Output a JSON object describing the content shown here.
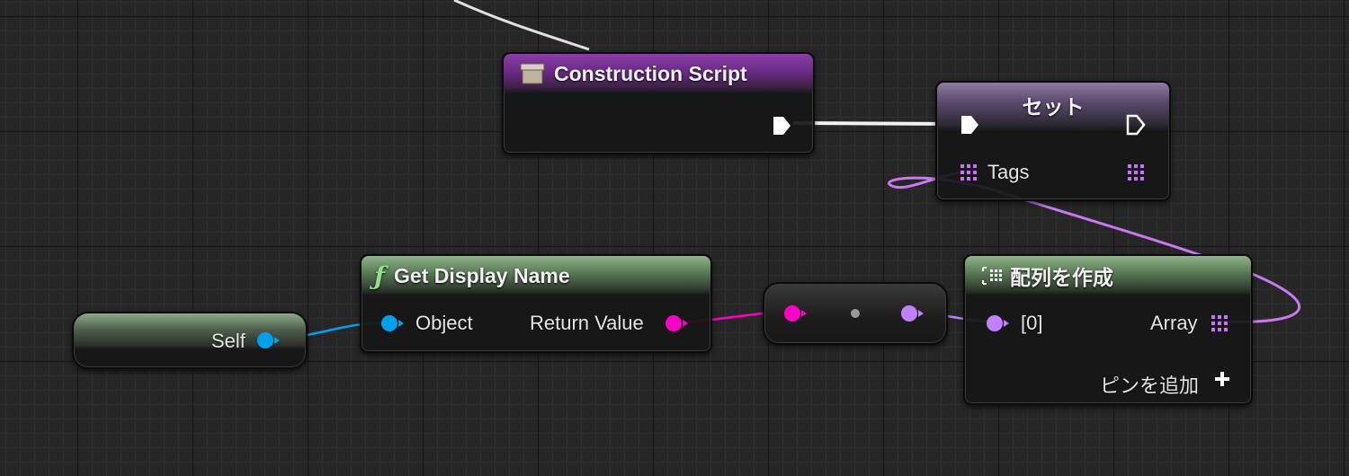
{
  "colors": {
    "exec": "#ffffff",
    "object_pin": "#00a0f0",
    "string_pin": "#ff00c8",
    "name_pin": "#c080ff",
    "array_pin": "#c870ff",
    "event_header": "#7b3598",
    "function_header": "#66885f"
  },
  "nodes": {
    "construction_script": {
      "title": "Construction Script",
      "icon": "event-box-icon"
    },
    "set_tags": {
      "title": "セット",
      "input_label": "Tags"
    },
    "self_node": {
      "label": "Self"
    },
    "get_display_name": {
      "title": "Get Display Name",
      "icon": "function-icon",
      "input_label": "Object",
      "output_label": "Return Value"
    },
    "conversion": {
      "icon": "conversion-dot-icon"
    },
    "make_array": {
      "title": "配列を作成",
      "icon": "make-array-icon",
      "input_label": "[0]",
      "output_label": "Array",
      "add_pin_label": "ピンを追加"
    }
  }
}
